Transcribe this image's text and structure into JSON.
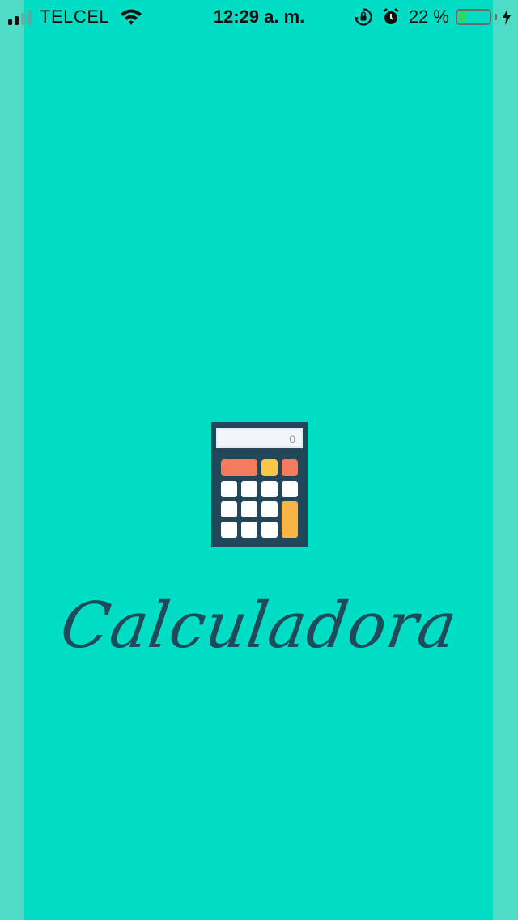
{
  "status_bar": {
    "carrier": "TELCEL",
    "time": "12:29 a. m.",
    "battery_percent": "22 %",
    "battery_level": 0.22,
    "icons": [
      "signal-icon",
      "wifi-icon",
      "orientation-lock-icon",
      "alarm-icon",
      "battery-icon",
      "charging-bolt-icon"
    ]
  },
  "splash": {
    "title": "Calculadora",
    "icon": "calculator-icon"
  },
  "colors": {
    "background": "#00DDC5",
    "letterbox": "#4FDCC6",
    "title": "#1E4A5C",
    "calc_body": "#22465A",
    "calc_red": "#F47A5E",
    "calc_yellow": "#F8C747",
    "calc_orange": "#F6B544",
    "calc_key": "#FFFFFF"
  }
}
